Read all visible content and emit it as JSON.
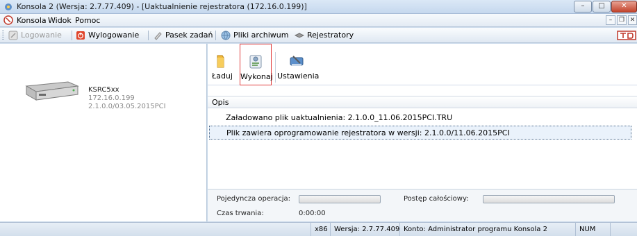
{
  "window": {
    "title": "Konsola 2 (Wersja:  2.7.77.409) - [Uaktualnienie rejestratora (172.16.0.199)]",
    "controls": {
      "minimize": "–",
      "maximize": "□",
      "close": "✕"
    }
  },
  "menubar": {
    "items": [
      "Konsola",
      "Widok",
      "Pomoc"
    ],
    "mdi_controls": {
      "minimize": "–",
      "restore": "❐",
      "close": "✕"
    }
  },
  "toolbar": {
    "items": [
      {
        "label": "Logowanie",
        "icon": "login-icon",
        "enabled": false
      },
      {
        "label": "Wylogowanie",
        "icon": "logout-icon",
        "enabled": true
      },
      {
        "label": "Pasek zadań",
        "icon": "pen-icon",
        "enabled": true
      },
      {
        "label": "Pliki archiwum",
        "icon": "globe-icon",
        "enabled": true
      },
      {
        "label": "Rejestratory",
        "icon": "recorder-icon",
        "enabled": true
      }
    ]
  },
  "device": {
    "name": "KSRC5xx",
    "ip": "172.16.0.199",
    "version": "2.1.0.0/03.05.2015PCI"
  },
  "ribbon": {
    "buttons": [
      {
        "label": "Ładuj",
        "icon": "folder-icon"
      },
      {
        "label": "Wykonaj",
        "icon": "execute-icon"
      },
      {
        "label": "Ustawienia",
        "icon": "settings-icon"
      }
    ]
  },
  "grid": {
    "header": "Opis",
    "rows": [
      "Załadowano plik uaktualnienia: 2.1.0.0_11.06.2015PCI.TRU",
      "Plik zawiera oprogramowanie rejestratora w wersji: 2.1.0.0/11.06.2015PCI"
    ]
  },
  "progress": {
    "single_label": "Pojedyncza operacja:",
    "overall_label": "Postęp całościowy:",
    "duration_label": "Czas trwania:",
    "duration_value": "0:00:00",
    "single_value": 0,
    "overall_value": 0
  },
  "statusbar": {
    "arch": "x86",
    "version": "Wersja: 2.7.77.409",
    "account": "Konto: Administrator programu Konsola 2",
    "numlock": "NUM"
  },
  "colors": {
    "highlight_border": "#e03a3a",
    "progress_fill": "#5cc35c"
  }
}
